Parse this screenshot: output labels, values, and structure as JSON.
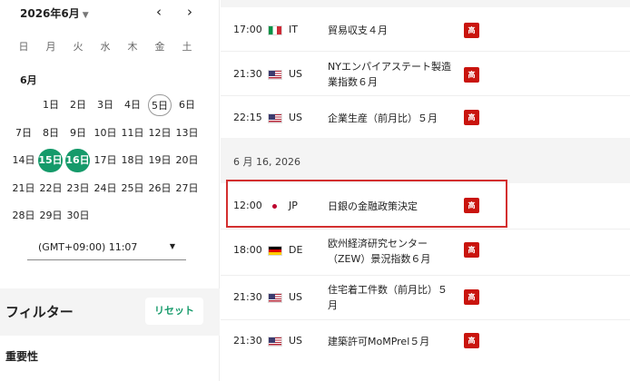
{
  "calendar": {
    "month_title": "2026年6月",
    "weekdays": [
      "日",
      "月",
      "火",
      "水",
      "木",
      "金",
      "土"
    ],
    "month_label": "6月",
    "prev_icon": "‹",
    "next_icon": "›",
    "days": [
      [
        "",
        "1日",
        "2日",
        "3日",
        "4日",
        "5日",
        "6日"
      ],
      [
        "7日",
        "8日",
        "9日",
        "10日",
        "11日",
        "12日",
        "13日"
      ],
      [
        "14日",
        "15日",
        "16日",
        "17日",
        "18日",
        "19日",
        "20日"
      ],
      [
        "21日",
        "22日",
        "23日",
        "24日",
        "25日",
        "26日",
        "27日"
      ],
      [
        "28日",
        "29日",
        "30日",
        "",
        "",
        "",
        ""
      ]
    ],
    "today": "5日",
    "selected": [
      "15日",
      "16日"
    ],
    "accent_color": "#159a6a"
  },
  "timezone": {
    "value": "(GMT+09:00) 11:07"
  },
  "filter": {
    "title": "フィルター",
    "reset_label": "リセット",
    "importance_label": "重要性"
  },
  "events": {
    "group1": [
      {
        "time": "17:00",
        "flag": "IT",
        "country": "IT",
        "event": "貿易収支４月",
        "importance": "高"
      },
      {
        "time": "21:30",
        "flag": "US",
        "country": "US",
        "event": "NYエンパイアステート製造業指数６月",
        "importance": "高"
      },
      {
        "time": "22:15",
        "flag": "US",
        "country": "US",
        "event": "企業生産（前月比）５月",
        "importance": "高"
      }
    ],
    "date_separator": "6 月 16, 2026",
    "group2": [
      {
        "time": "12:00",
        "flag": "JP",
        "country": "JP",
        "event": "日銀の金融政策決定",
        "importance": "高"
      },
      {
        "time": "18:00",
        "flag": "DE",
        "country": "DE",
        "event": "欧州経済研究センター（ZEW）景況指数６月",
        "importance": "高"
      },
      {
        "time": "21:30",
        "flag": "US",
        "country": "US",
        "event": "住宅着工件数（前月比）５月",
        "importance": "高"
      },
      {
        "time": "21:30",
        "flag": "US",
        "country": "US",
        "event": "建築許可MoMPrel５月",
        "importance": "高"
      }
    ],
    "importance_color": "#c9140d",
    "highlight_color": "#d32f2f"
  }
}
